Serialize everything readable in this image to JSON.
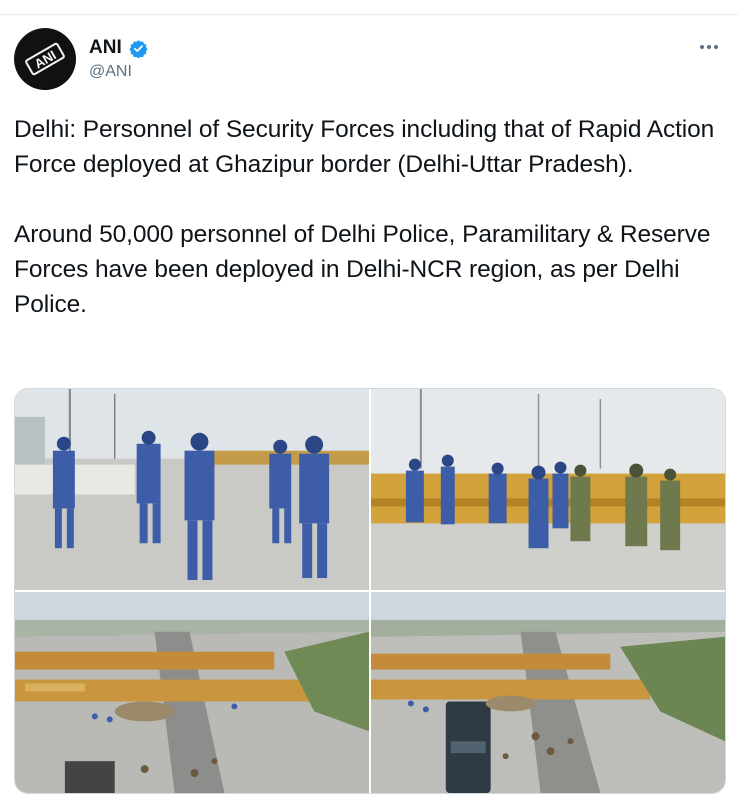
{
  "account": {
    "display_name": "ANI",
    "handle": "@ANI",
    "avatar_text": "ANI",
    "verified": true
  },
  "tweet": {
    "paragraph1": "Delhi: Personnel of Security Forces including that of Rapid Action Force deployed at Ghazipur border (Delhi-Uttar Pradesh).",
    "paragraph2": "Around 50,000 personnel of Delhi Police, Paramilitary & Reserve Forces have been deployed in Delhi-NCR region, as per Delhi Police."
  },
  "colors": {
    "text": "#0f1419",
    "secondary": "#5b7083",
    "verified": "#1d9bf0",
    "border": "#cfd9de"
  },
  "icons": {
    "verified": "verified-badge-icon",
    "more": "more-options-icon"
  },
  "media": {
    "count": 4
  }
}
